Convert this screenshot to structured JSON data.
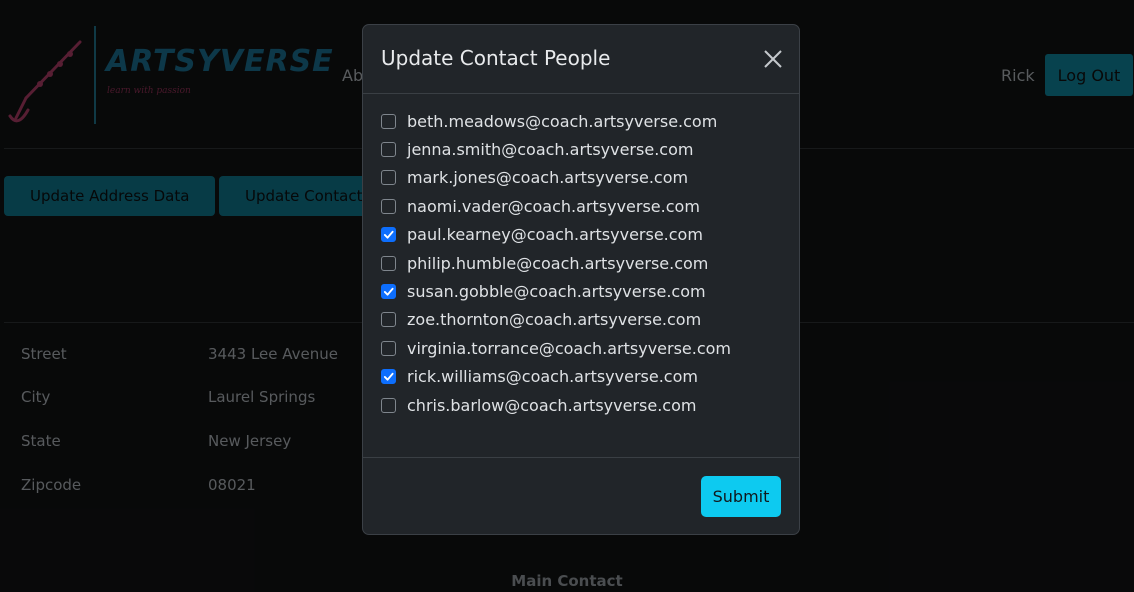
{
  "brand": {
    "name": "ARTSYVERSE",
    "tagline": "learn with passion"
  },
  "nav": {
    "link_partial": "Ab",
    "user": "Rick",
    "logout_label": "Log Out"
  },
  "actions": {
    "update_address_label": "Update Address Data",
    "update_contact_label": "Update Contact"
  },
  "address": [
    {
      "label": "Street",
      "value": "3443 Lee Avenue"
    },
    {
      "label": "City",
      "value": "Laurel Springs"
    },
    {
      "label": "State",
      "value": "New Jersey"
    },
    {
      "label": "Zipcode",
      "value": "08021"
    }
  ],
  "main_contact_heading": "Main Contact",
  "modal": {
    "title": "Update Contact People",
    "close_icon": "close-icon",
    "submit_label": "Submit",
    "contacts": [
      {
        "email": "beth.meadows@coach.artsyverse.com",
        "checked": false
      },
      {
        "email": "jenna.smith@coach.artsyverse.com",
        "checked": false
      },
      {
        "email": "mark.jones@coach.artsyverse.com",
        "checked": false
      },
      {
        "email": "naomi.vader@coach.artsyverse.com",
        "checked": false
      },
      {
        "email": "paul.kearney@coach.artsyverse.com",
        "checked": true
      },
      {
        "email": "philip.humble@coach.artsyverse.com",
        "checked": false
      },
      {
        "email": "susan.gobble@coach.artsyverse.com",
        "checked": true
      },
      {
        "email": "zoe.thornton@coach.artsyverse.com",
        "checked": false
      },
      {
        "email": "virginia.torrance@coach.artsyverse.com",
        "checked": false
      },
      {
        "email": "rick.williams@coach.artsyverse.com",
        "checked": true
      },
      {
        "email": "chris.barlow@coach.artsyverse.com",
        "checked": false
      }
    ]
  },
  "colors": {
    "accent": "#0e7287",
    "submit": "#0dcaf0",
    "checkbox_checked": "#0d6efd",
    "brand_text": "#1a6c8c",
    "tagline": "#8b2f52"
  }
}
